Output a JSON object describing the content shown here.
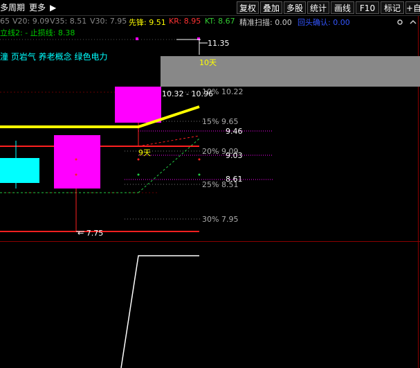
{
  "toolbar": {
    "left_items": [
      "多周期",
      "更多"
    ],
    "buttons": [
      "复权",
      "叠加",
      "多股",
      "统计",
      "画线",
      "F10",
      "标记",
      "+自"
    ]
  },
  "ma_line": {
    "items": [
      {
        "label": "65",
        "color": "#888888"
      },
      {
        "label": "V20: 9.09",
        "color": "#888888"
      },
      {
        "label": "V35: 8.51",
        "color": "#888888"
      },
      {
        "label": "V30: 7.95",
        "color": "#888888"
      },
      {
        "label": "先锋: 9.51",
        "color": "#ffff00"
      },
      {
        "label": "KR: 8.95",
        "color": "#ff3333"
      },
      {
        "label": "KT: 8.67",
        "color": "#33cc33"
      },
      {
        "label": "精准扫描: 0.00",
        "color": "#cccccc"
      },
      {
        "label": "回头确认: 0.00",
        "color": "#3355ff"
      }
    ]
  },
  "stop_line": "立线2: - 止损线: 8.38",
  "concepts": "潼 页岩气 养老概念 绿色电力",
  "labels": {
    "high_price": "11.35",
    "days_10": "10天",
    "range": "10.32 - 10.96",
    "days_9": "9天",
    "low_price": "7.75",
    "fib_10": "10% 10.22",
    "fib_15": "15% 9.65",
    "fib_20": "20% 9.09",
    "fib_25": "25% 8.51",
    "fib_30": "30% 7.95",
    "level_946": "9.46",
    "level_903": "9.03",
    "level_861": "8.61"
  },
  "colors": {
    "yellow": "#ffff00",
    "red": "#ff2020",
    "magenta": "#ff00ff",
    "cyan": "#00ffff",
    "grey_box": "#888888",
    "fib": "#aaaaaa",
    "green": "#22cc44"
  }
}
